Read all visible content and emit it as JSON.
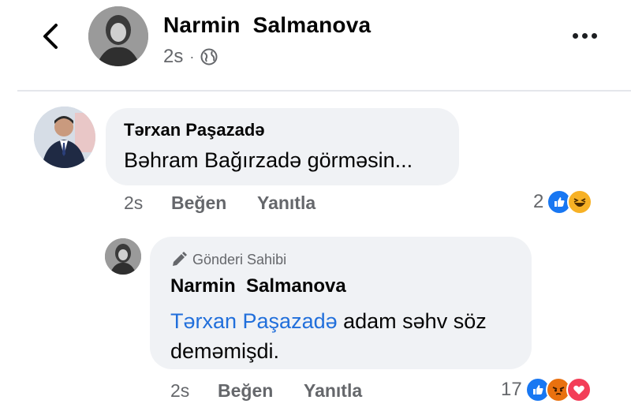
{
  "post": {
    "author": "Narmin  Salmanova",
    "time": "2s",
    "audience_icon": "globe-icon"
  },
  "comments": [
    {
      "author": "Tərxan Paşazadə",
      "text": "Bəhram Bağırzadə görməsin...",
      "time": "2s",
      "like_label": "Beğen",
      "reply_label": "Yanıtla",
      "reaction_count": "2",
      "reactions": [
        "like",
        "haha"
      ]
    }
  ],
  "reply": {
    "badge": "Gönderi Sahibi",
    "author": "Narmin  Salmanova",
    "mention": "Tərxan Paşazadə",
    "text_line1": " adam səhv söz",
    "text_line2": "deməmişdi.",
    "time": "2s",
    "like_label": "Beğen",
    "reply_label": "Yanıtla",
    "reaction_count": "17",
    "reactions": [
      "like",
      "angry",
      "love"
    ]
  },
  "colors": {
    "like": "#1877f2",
    "haha": "#f7b125",
    "angry": "#e9710f",
    "love": "#f33e58",
    "mention": "#216fdb",
    "bubble": "#f0f2f5"
  }
}
